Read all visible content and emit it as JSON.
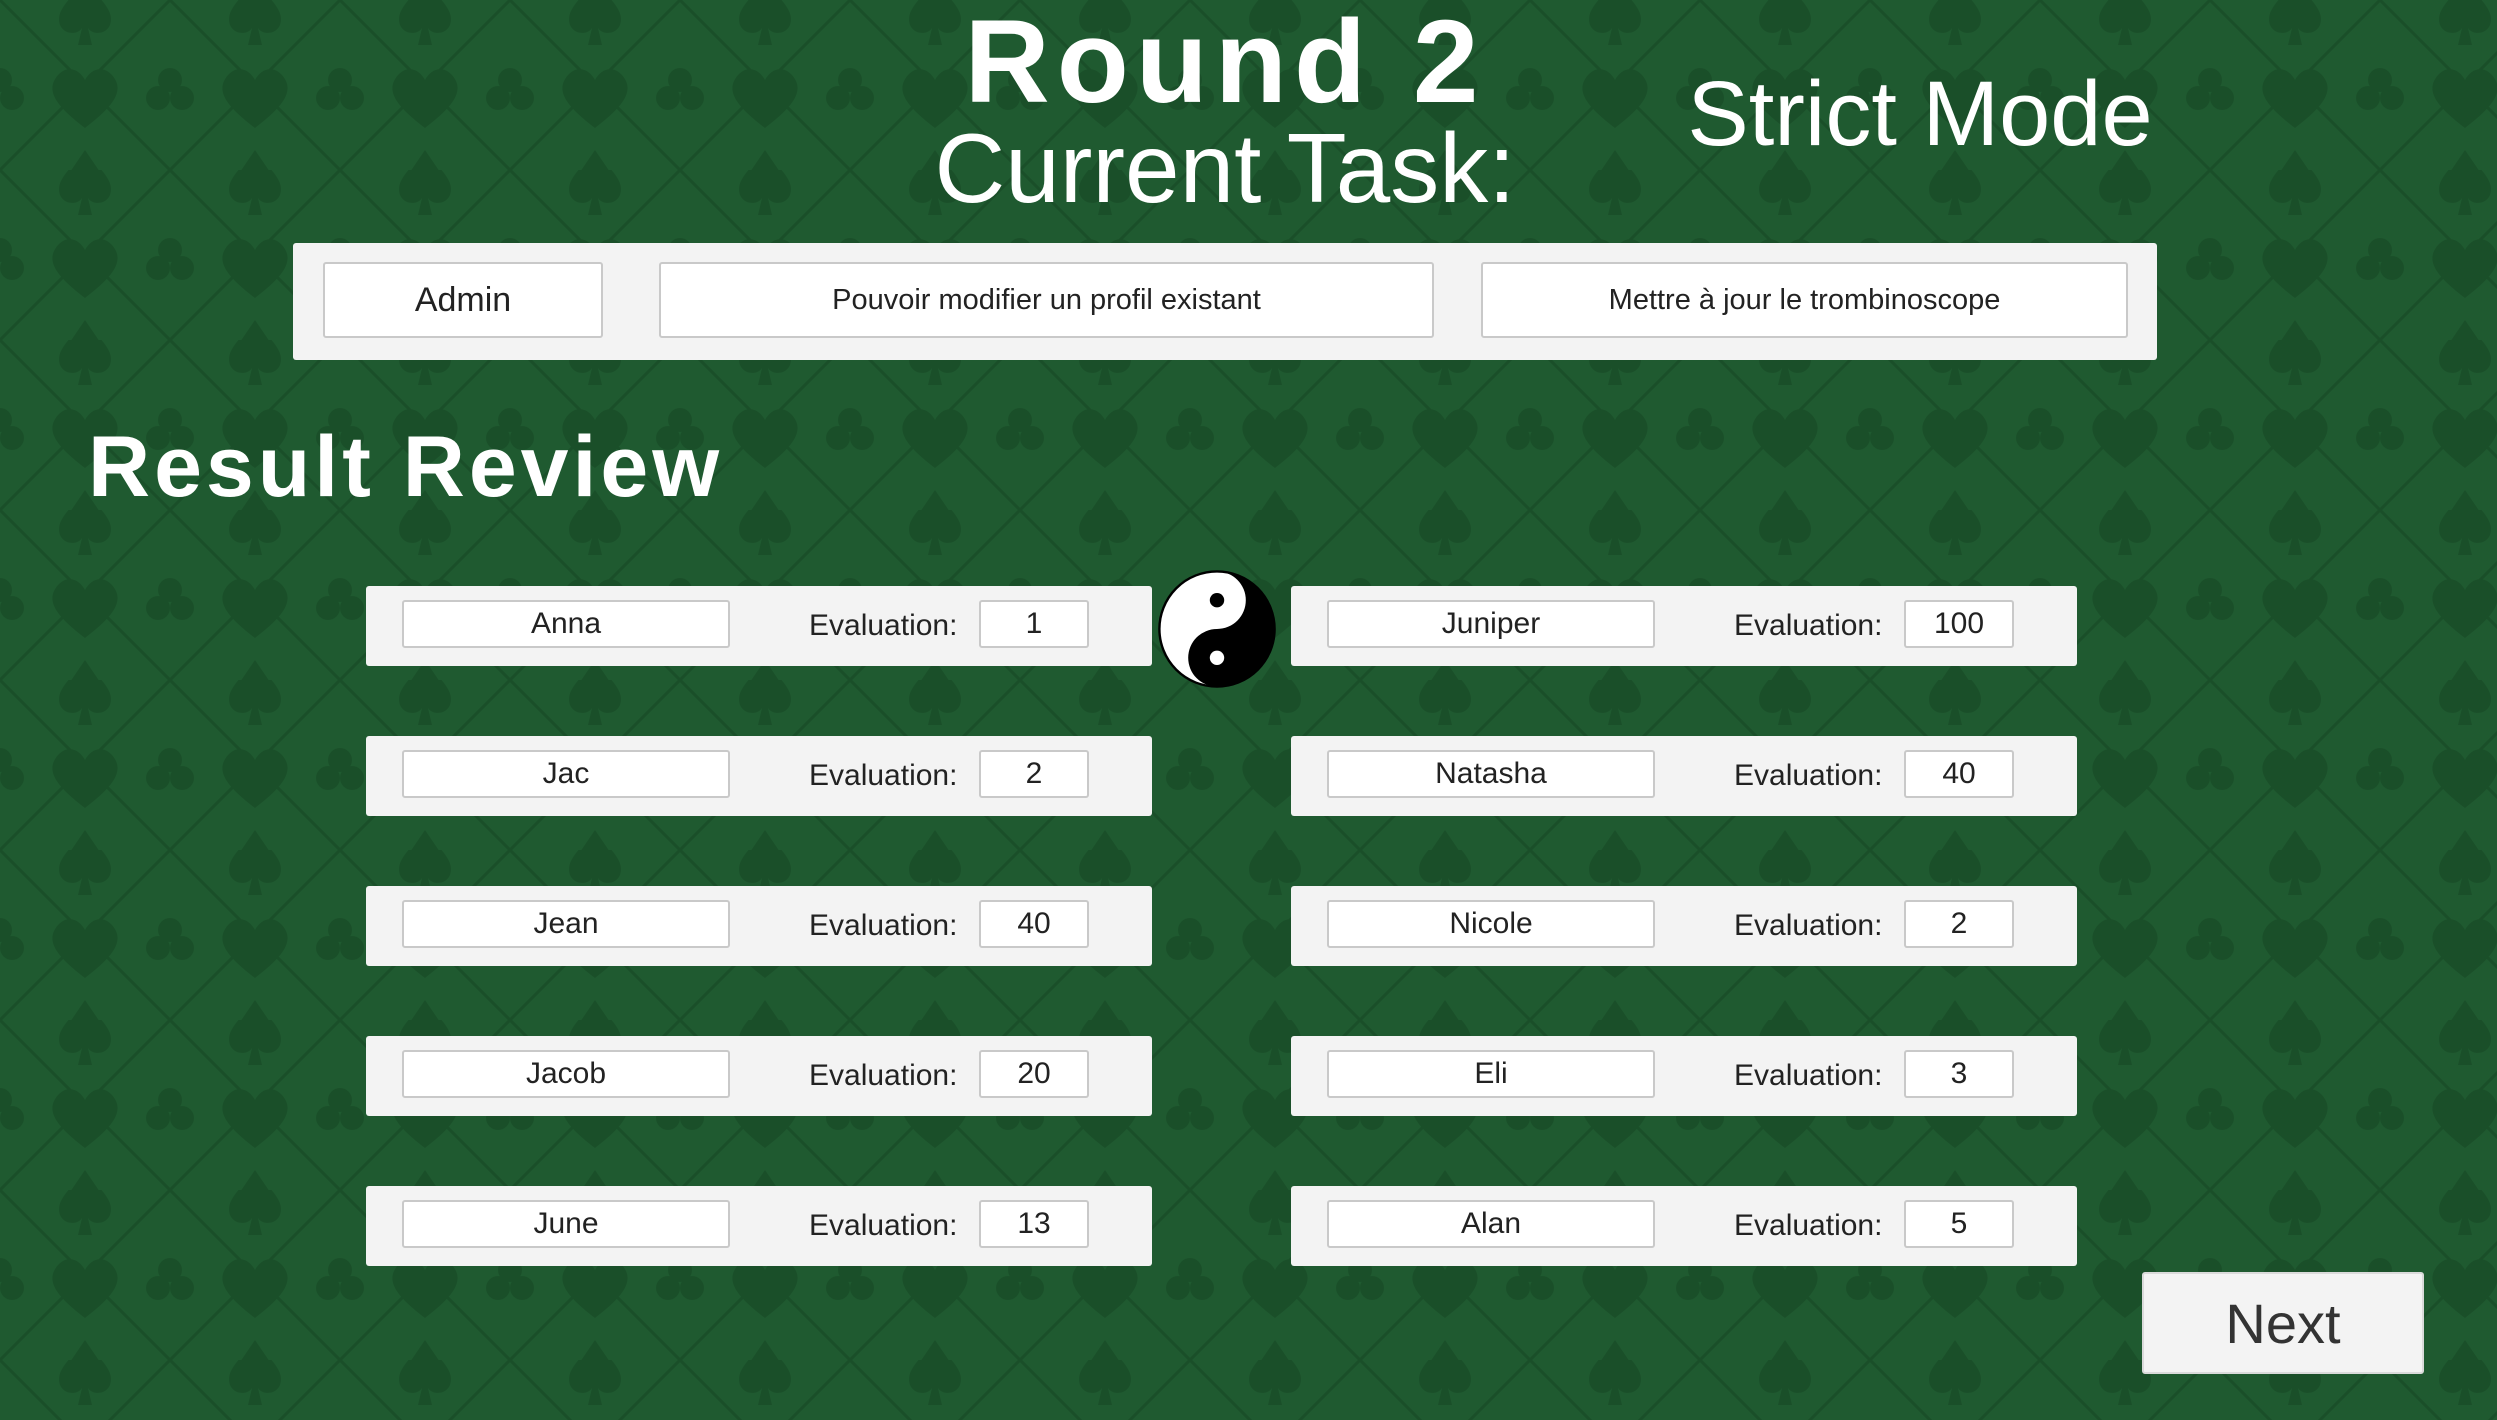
{
  "header": {
    "round_title": "Round 2",
    "task_title": "Current Task:",
    "mode_title": "Strict Mode"
  },
  "task": {
    "role": "Admin",
    "goal": "Pouvoir modifier un profil existant",
    "action": "Mettre à jour le trombinoscope"
  },
  "review": {
    "title": "Result Review",
    "evaluation_label": "Evaluation:",
    "left": [
      {
        "name": "Anna",
        "score": "1"
      },
      {
        "name": "Jac",
        "score": "2"
      },
      {
        "name": "Jean",
        "score": "40"
      },
      {
        "name": "Jacob",
        "score": "20"
      },
      {
        "name": "June",
        "score": "13"
      }
    ],
    "right": [
      {
        "name": "Juniper",
        "score": "100"
      },
      {
        "name": "Natasha",
        "score": "40"
      },
      {
        "name": "Nicole",
        "score": "2"
      },
      {
        "name": "Eli",
        "score": "3"
      },
      {
        "name": "Alan",
        "score": "5"
      }
    ]
  },
  "icons": {
    "center_icon": "yin-yang-icon",
    "background_pattern": "card-suits-pattern"
  },
  "colors": {
    "background": "#1f5a30",
    "panel": "#f3f3f3",
    "text_light": "#ffffff"
  },
  "footer": {
    "next_label": "Next"
  }
}
